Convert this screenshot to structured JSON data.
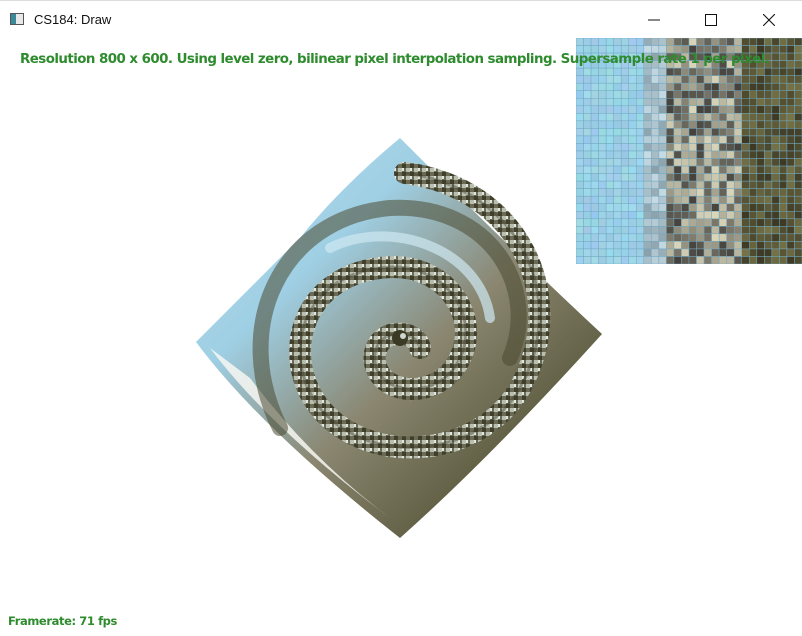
{
  "window": {
    "title": "CS184: Draw",
    "icon": "app-window-icon",
    "controls": [
      "minimize-icon",
      "maximize-icon",
      "close-icon"
    ]
  },
  "canvas": {
    "status_line": "Resolution 800 x 600. Using level zero, bilinear pixel interpolation sampling. Supersample rate 1 per pixel.",
    "framerate": "Framerate: 71 fps"
  },
  "colors": {
    "status_text": "#2e8b2e",
    "sky_blue": "#9fcfe4",
    "olive_dark": "#4a4a2e",
    "stone_gray": "#8a8670"
  }
}
